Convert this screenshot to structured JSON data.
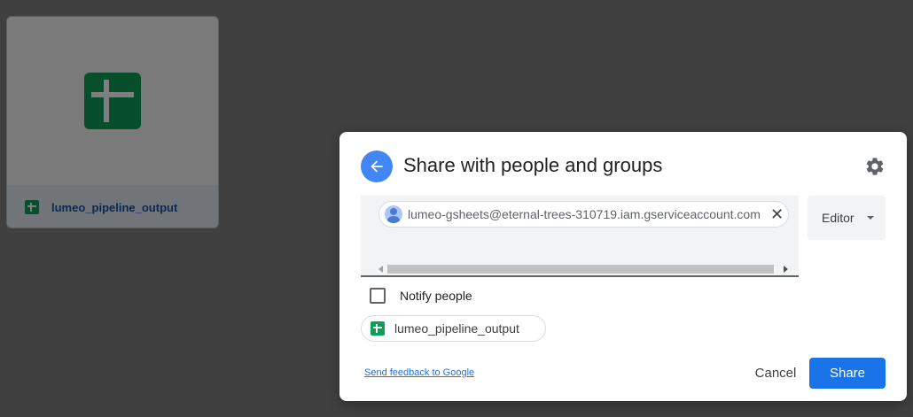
{
  "background_file": {
    "name": "lumeo_pipeline_output",
    "icon": "google-sheets-icon"
  },
  "dialog": {
    "title": "Share with people and groups",
    "back_icon": "arrow-left-icon",
    "settings_icon": "gear-icon",
    "recipient": {
      "email": "lumeo-gsheets@eternal-trees-310719.iam.gserviceaccount.com",
      "avatar_icon": "person-icon",
      "remove_icon": "close-icon",
      "remove_glyph": "✕"
    },
    "role": {
      "selected": "Editor",
      "icon": "caret-down-icon"
    },
    "notify": {
      "label": "Notify people",
      "checked": false
    },
    "file_chip": {
      "label": "lumeo_pipeline_output",
      "icon": "google-sheets-icon"
    },
    "feedback_link": "Send feedback to Google",
    "cancel_label": "Cancel",
    "share_label": "Share"
  },
  "colors": {
    "accent": "#1a73e8",
    "back_button": "#4285f4",
    "sheets_green": "#0f9d58"
  }
}
